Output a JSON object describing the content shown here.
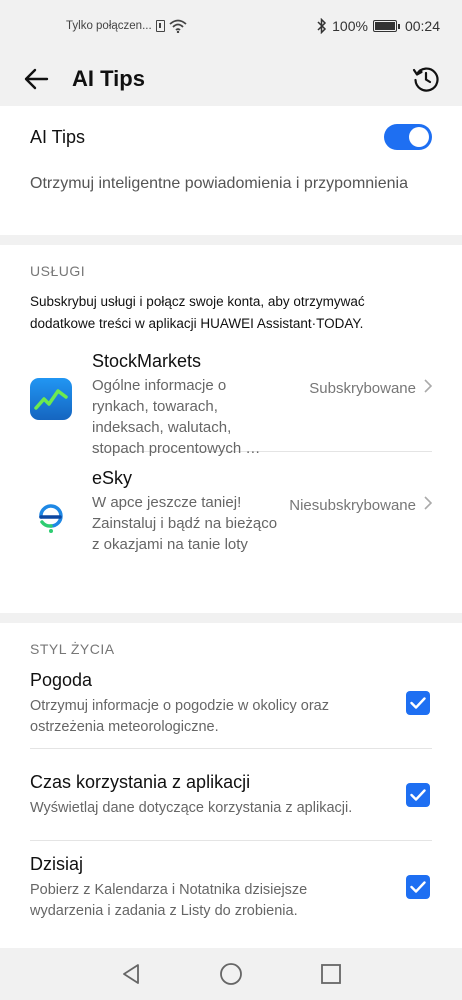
{
  "status_bar": {
    "carrier": "Tylko połączen...",
    "battery": "100%",
    "time": "00:24"
  },
  "app_bar": {
    "title": "AI Tips",
    "back_icon": "back-arrow-icon",
    "history_icon": "history-icon"
  },
  "ai_tips": {
    "label": "AI Tips",
    "enabled": true,
    "description": "Otrzymuj inteligentne powiadomienia i przypomnienia",
    "accent_color": "#1e6ff2"
  },
  "services": {
    "header": "USŁUGI",
    "description": "Subskrybuj usługi i połącz swoje konta, aby otrzymywać dodatkowe treści w aplikacji HUAWEI Assistant·TODAY.",
    "items": [
      {
        "name": "StockMarkets",
        "description": "Ogólne informacje o rynkach, towarach, indeksach, walutach, stopach procentowych …",
        "status": "Subskrybowane",
        "icon": "stock-chart-icon"
      },
      {
        "name": "eSky",
        "description": "W apce jeszcze taniej! Zainstaluj i bądź na bieżąco z okazjami na tanie loty",
        "status": "Niesubskrybowane",
        "icon": "esky-logo-icon"
      }
    ]
  },
  "lifestyle": {
    "header": "STYL ŻYCIA",
    "items": [
      {
        "title": "Pogoda",
        "description": "Otrzymuj informacje o pogodzie w okolicy oraz ostrzeżenia meteorologiczne.",
        "checked": true
      },
      {
        "title": "Czas korzystania z aplikacji",
        "description": "Wyświetlaj dane dotyczące korzystania z aplikacji.",
        "checked": true
      },
      {
        "title": "Dzisiaj",
        "description": "Pobierz z Kalendarza i Notatnika dzisiejsze wydarzenia i zadania z Listy do zrobienia.",
        "checked": true
      }
    ]
  },
  "nav_bar": {
    "back": "triangle-back-icon",
    "home": "circle-home-icon",
    "recents": "square-recents-icon"
  }
}
